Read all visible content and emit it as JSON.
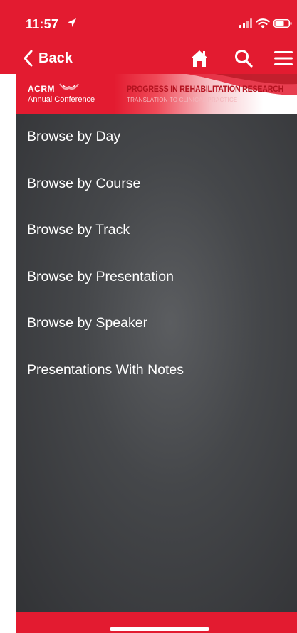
{
  "status_bar": {
    "time": "11:57",
    "icons": [
      "location-arrow-icon",
      "cellular-signal-icon",
      "wifi-icon",
      "battery-icon"
    ]
  },
  "nav": {
    "back_label": "Back",
    "icons": [
      "home-icon",
      "search-icon",
      "hamburger-menu-icon"
    ]
  },
  "banner": {
    "org": "ACRM",
    "subtitle": "Annual Conference",
    "title": "PROGRESS IN REHABILITATION RESEARCH",
    "tagline": "TRANSLATION TO CLINICAL PRACTICE"
  },
  "menu": {
    "items": [
      {
        "label": "Browse by Day"
      },
      {
        "label": "Browse by Course"
      },
      {
        "label": "Browse by Track"
      },
      {
        "label": "Browse by Presentation"
      },
      {
        "label": "Browse by Speaker"
      },
      {
        "label": "Presentations With Notes"
      }
    ]
  },
  "colors": {
    "brand_red": "#e31b30",
    "content_bg": "#45474a",
    "text": "#ffffff"
  }
}
